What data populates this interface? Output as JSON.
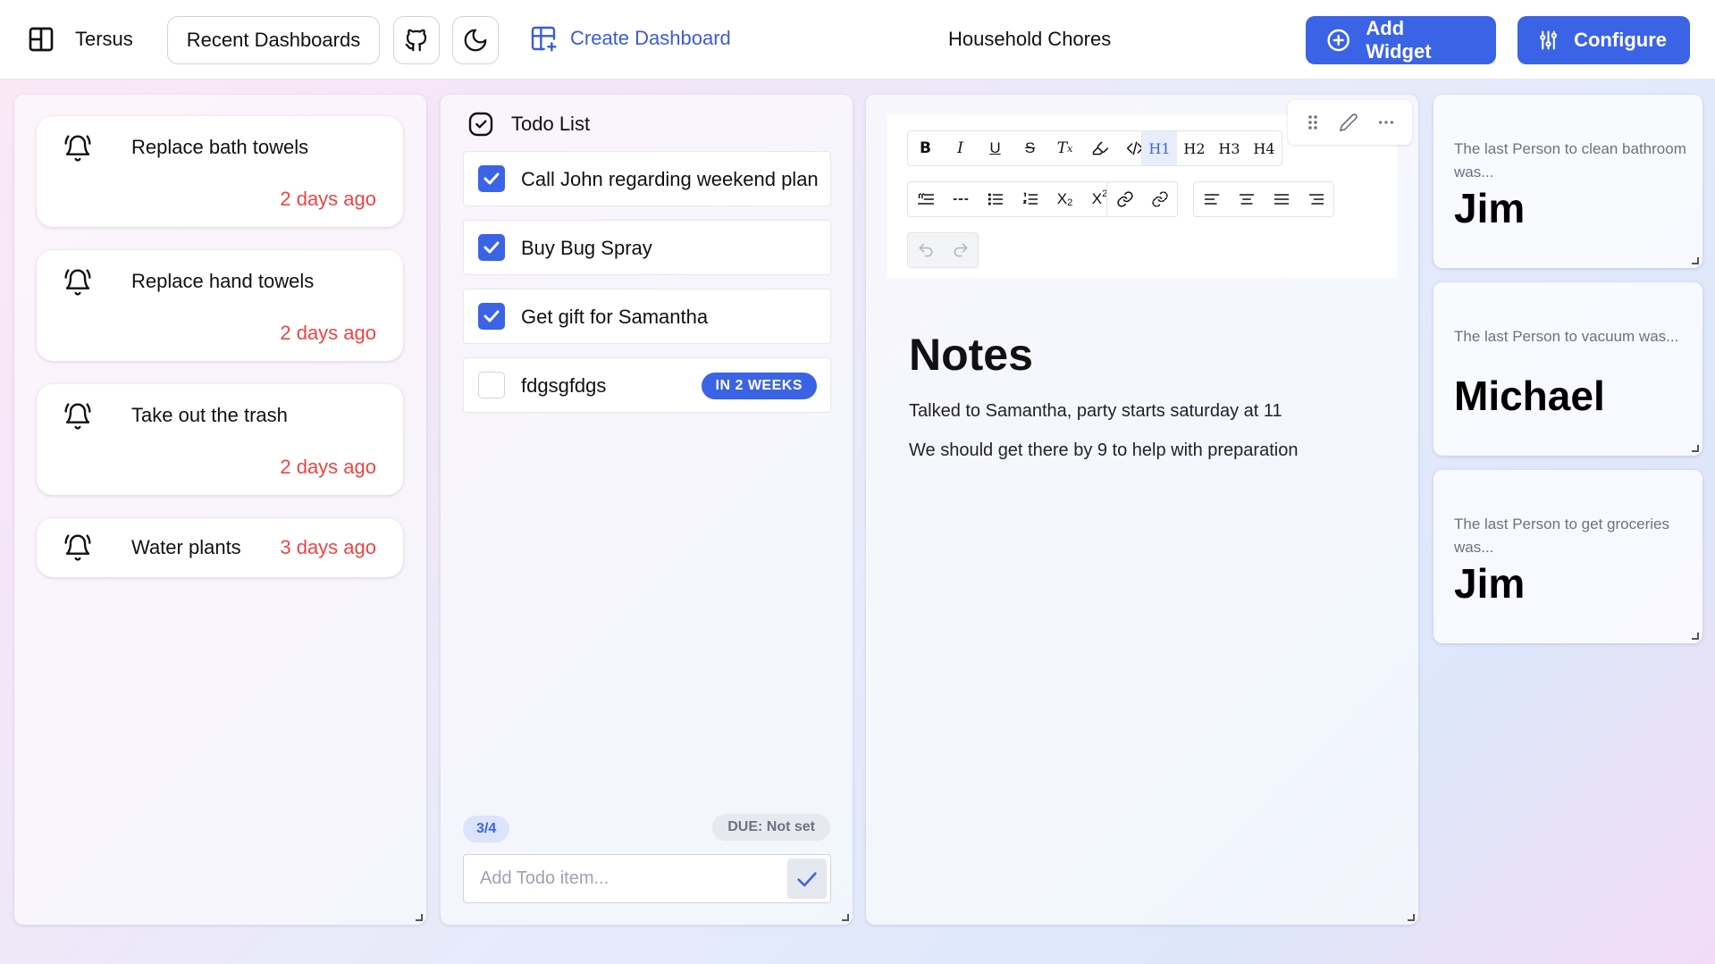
{
  "header": {
    "brand": "Tersus",
    "recent_label": "Recent Dashboards",
    "create_label": "Create Dashboard",
    "dashboard_title": "Household Chores",
    "add_widget_label": "Add Widget",
    "configure_label": "Configure",
    "icons": [
      "layout-icon",
      "github-icon",
      "moon-icon",
      "table-plus-icon",
      "plus-circle-icon",
      "sliders-icon"
    ]
  },
  "reminders": [
    {
      "title": "Replace bath towels",
      "time": "2 days ago"
    },
    {
      "title": "Replace hand towels",
      "time": "2 days ago"
    },
    {
      "title": "Take out the trash",
      "time": "2 days ago"
    },
    {
      "title": "Water plants",
      "time": "3 days ago"
    }
  ],
  "todo": {
    "title": "Todo List",
    "items": [
      {
        "text": "Call John regarding weekend plan",
        "checked": true
      },
      {
        "text": "Buy Bug Spray",
        "checked": true
      },
      {
        "text": "Get gift for Samantha",
        "checked": true
      },
      {
        "text": "fdgsgfdgs",
        "checked": false,
        "badge": "IN 2 WEEKS"
      }
    ],
    "count": "3/4",
    "due": "DUE: Not set",
    "add_placeholder": "Add Todo item..."
  },
  "notes": {
    "toolbar_row1": [
      "B",
      "I",
      "U",
      "S",
      "Tx",
      "highlight",
      "</>",
      "H1",
      "H2",
      "H3",
      "H4"
    ],
    "heading_labels": {
      "h1": "H1",
      "h2": "H2",
      "h3": "H3",
      "h4": "H4"
    },
    "title": "Notes",
    "lines": [
      "Talked to Samantha, party starts saturday at 11",
      "We should get there by 9 to help with preparation"
    ]
  },
  "stats": [
    {
      "label": "The last Person to clean bathroom was...",
      "value": "Jim"
    },
    {
      "label": "The last Person to vacuum was...",
      "value": "Michael"
    },
    {
      "label": "The last Person to get groceries was...",
      "value": "Jim"
    }
  ],
  "colors": {
    "accent": "#3b63e6",
    "overdue": "#ef4444"
  }
}
